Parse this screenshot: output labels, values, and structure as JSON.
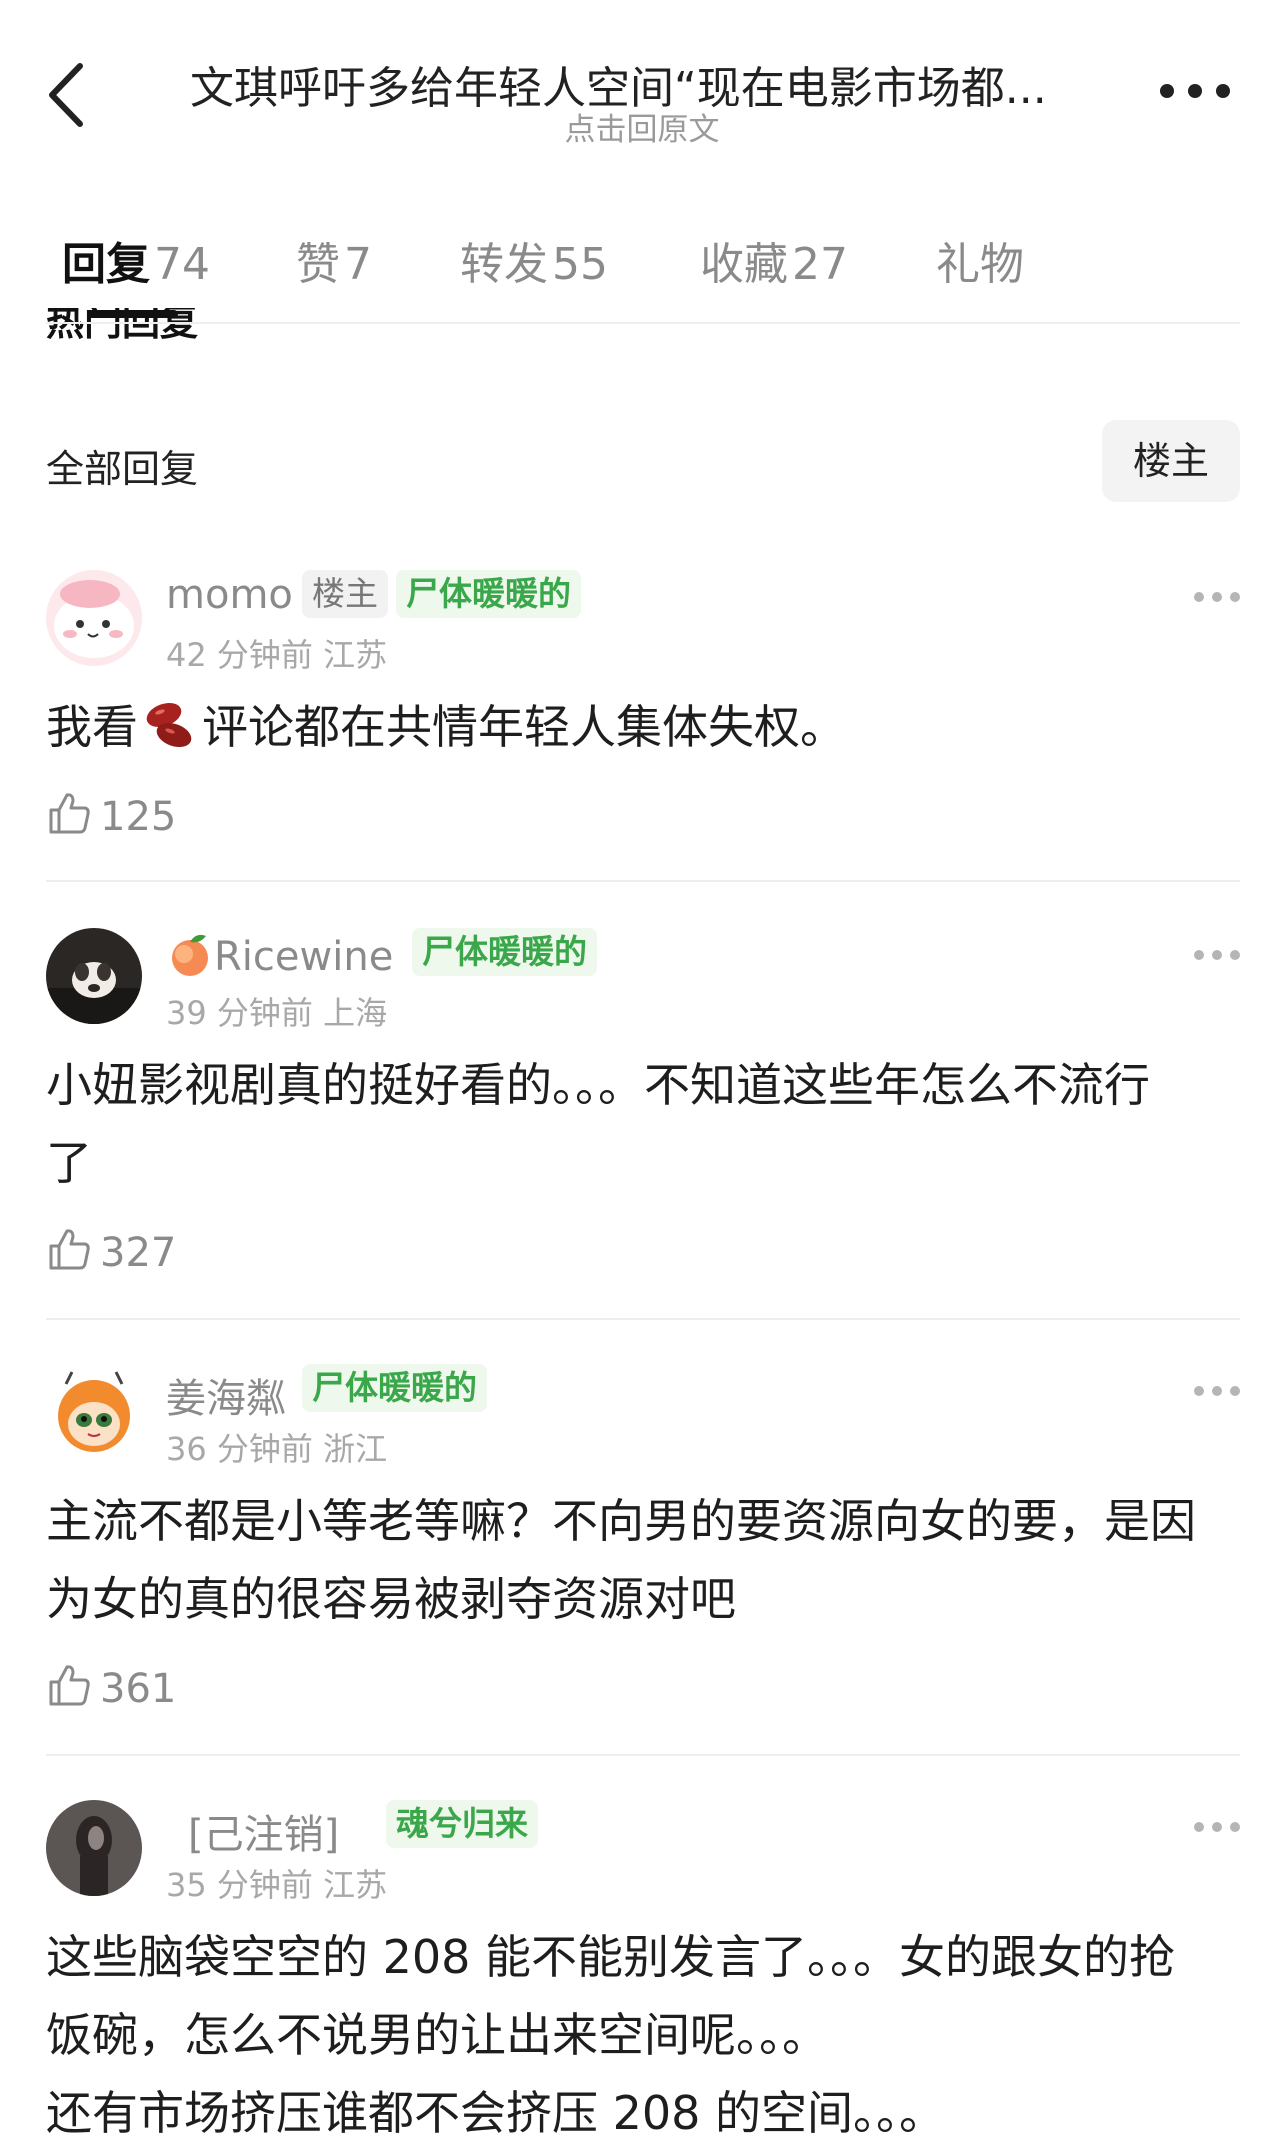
{
  "header": {
    "title": "文琪呼吁多给年轻人空间“现在电影市场都...",
    "subtitle": "点击回原文"
  },
  "tabs": [
    {
      "label": "回复",
      "count": "74"
    },
    {
      "label": "赞",
      "count": "7"
    },
    {
      "label": "转发",
      "count": "55"
    },
    {
      "label": "收藏",
      "count": "27"
    },
    {
      "label": "礼物",
      "count": ""
    }
  ],
  "hot_label": "热门回复",
  "section": {
    "title": "全部回复",
    "filter_label": "楼主"
  },
  "comments": [
    {
      "username": "momo",
      "owner_tag": "楼主",
      "badge": "尸体暖暖的",
      "time": "42 分钟前",
      "location": "江苏",
      "text_before_emoji": "我看",
      "text_after_emoji": "评论都在共情年轻人集体失权。",
      "likes": "125"
    },
    {
      "username": "Ricewine",
      "badge": "尸体暖暖的",
      "time": "39 分钟前",
      "location": "上海",
      "text_lines": [
        "小妞影视剧真的挺好看的。。。不知道这些年怎么不流行",
        "了"
      ],
      "likes": "327"
    },
    {
      "username": "姜海粼",
      "badge": "尸体暖暖的",
      "time": "36 分钟前",
      "location": "浙江",
      "text_lines": [
        "主流不都是小等老等嘛？不向男的要资源向女的要，是因",
        "为女的真的很容易被剥夺资源对吧"
      ],
      "likes": "361"
    },
    {
      "username": "[己注销]",
      "badge": "魂兮归来",
      "time": "35 分钟前",
      "location": "江苏",
      "text_lines": [
        "这些脑袋空空的 208 能不能别发言了。。。女的跟女的抢",
        "饭碗，怎么不说男的让出来空间呢。。。",
        "还有市场挤压谁都不会挤压 208 的空间。。。"
      ]
    }
  ],
  "colors": {
    "badge_green": "#3aa84a",
    "badge_green_bg": "#eef8ec",
    "text_gray": "#8a8a8a"
  }
}
